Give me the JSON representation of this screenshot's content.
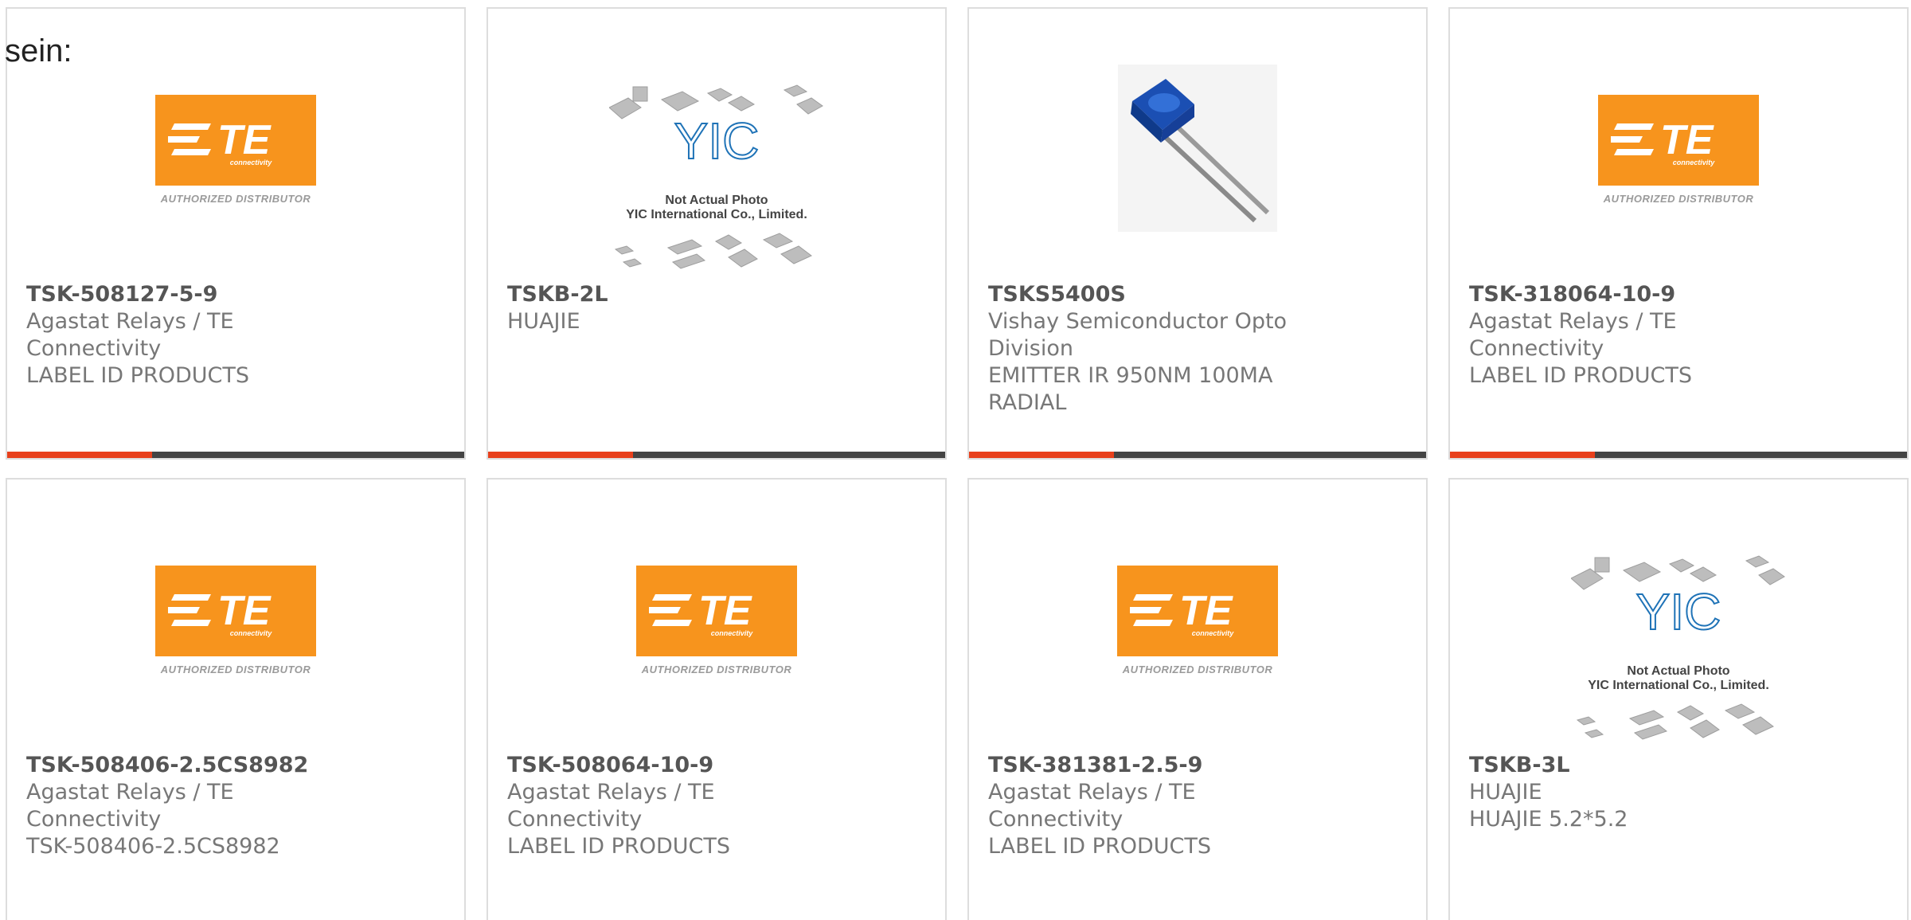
{
  "page": {
    "heading": "sein:"
  },
  "colors": {
    "card_border": "#dddddd",
    "bar_dark": "#444444",
    "bar_accent": "#e8401c",
    "te_orange": "#f7941d",
    "yic_blue": "#1f73b7"
  },
  "products": [
    {
      "image": "te-connectivity-logo",
      "logo_word": "TE",
      "logo_sub": "connectivity",
      "logo_caption": "AUTHORIZED DISTRIBUTOR",
      "part_number": "TSK-508127-5-9",
      "lines": [
        "Agastat Relays / TE Connectivity",
        "LABEL ID PRODUCTS"
      ]
    },
    {
      "image": "not-actual-photo-placeholder",
      "placeholder_logo": "YIC",
      "placeholder_caption_1": "Not Actual Photo",
      "placeholder_caption_2": "YIC International Co., Limited.",
      "part_number": "TSKB-2L",
      "lines": [
        "HUAJIE"
      ]
    },
    {
      "image": "infrared-emitter-photo",
      "part_number": "TSKS5400S",
      "lines": [
        "Vishay Semiconductor Opto Division",
        "EMITTER IR 950NM 100MA RADIAL"
      ]
    },
    {
      "image": "te-connectivity-logo",
      "logo_word": "TE",
      "logo_sub": "connectivity",
      "logo_caption": "AUTHORIZED DISTRIBUTOR",
      "part_number": "TSK-318064-10-9",
      "lines": [
        "Agastat Relays / TE Connectivity",
        "LABEL ID PRODUCTS"
      ]
    },
    {
      "image": "te-connectivity-logo",
      "logo_word": "TE",
      "logo_sub": "connectivity",
      "logo_caption": "AUTHORIZED DISTRIBUTOR",
      "part_number": "TSK-508406-2.5CS8982",
      "lines": [
        "Agastat Relays / TE Connectivity",
        "TSK-508406-2.5CS8982"
      ]
    },
    {
      "image": "te-connectivity-logo",
      "logo_word": "TE",
      "logo_sub": "connectivity",
      "logo_caption": "AUTHORIZED DISTRIBUTOR",
      "part_number": "TSK-508064-10-9",
      "lines": [
        "Agastat Relays / TE Connectivity",
        "LABEL ID PRODUCTS"
      ]
    },
    {
      "image": "te-connectivity-logo",
      "logo_word": "TE",
      "logo_sub": "connectivity",
      "logo_caption": "AUTHORIZED DISTRIBUTOR",
      "part_number": "TSK-381381-2.5-9",
      "lines": [
        "Agastat Relays / TE Connectivity",
        "LABEL ID PRODUCTS"
      ]
    },
    {
      "image": "not-actual-photo-placeholder",
      "placeholder_logo": "YIC",
      "placeholder_caption_1": "Not Actual Photo",
      "placeholder_caption_2": "YIC International Co., Limited.",
      "part_number": "TSKB-3L",
      "lines": [
        "HUAJIE",
        "HUAJIE 5.2*5.2"
      ]
    }
  ]
}
